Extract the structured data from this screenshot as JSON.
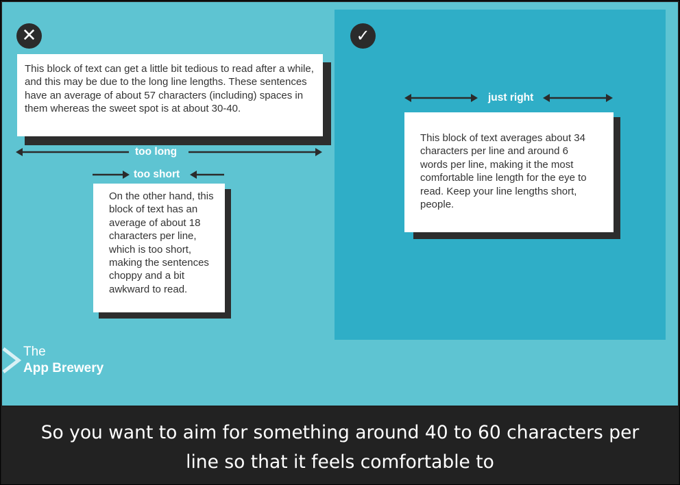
{
  "slide": {
    "bad_badge": "✕",
    "good_badge": "✓",
    "long_text": "This block of text can get a little bit tedious to read after a while, and this may be due to the long line lengths. These sentences have an average of about 57 characters (including) spaces in them whereas the sweet spot is at about 30-40.",
    "long_label": "too long",
    "short_label": "too short",
    "short_text": "On the other hand, this block of text has an average of about 18 characters per line, which is too short, making the sentences choppy and a bit awkward to read.",
    "right_label": "just right",
    "right_text": "This block of text averages about 34 characters per line and around 6 words per line, making it the most comfortable line length for the eye to read. Keep your line lengths short, people."
  },
  "logo": {
    "line1": "The",
    "line2": "App Brewery"
  },
  "caption": {
    "line1": "So you want to aim for something around 40 to 60 characters per",
    "line2": "line so that it feels comfortable to"
  },
  "colors": {
    "slide_bg": "#5ec4d2",
    "panel_bg": "#2faec7",
    "badge_bg": "#2b2b2b",
    "caption_bg": "#222222"
  }
}
